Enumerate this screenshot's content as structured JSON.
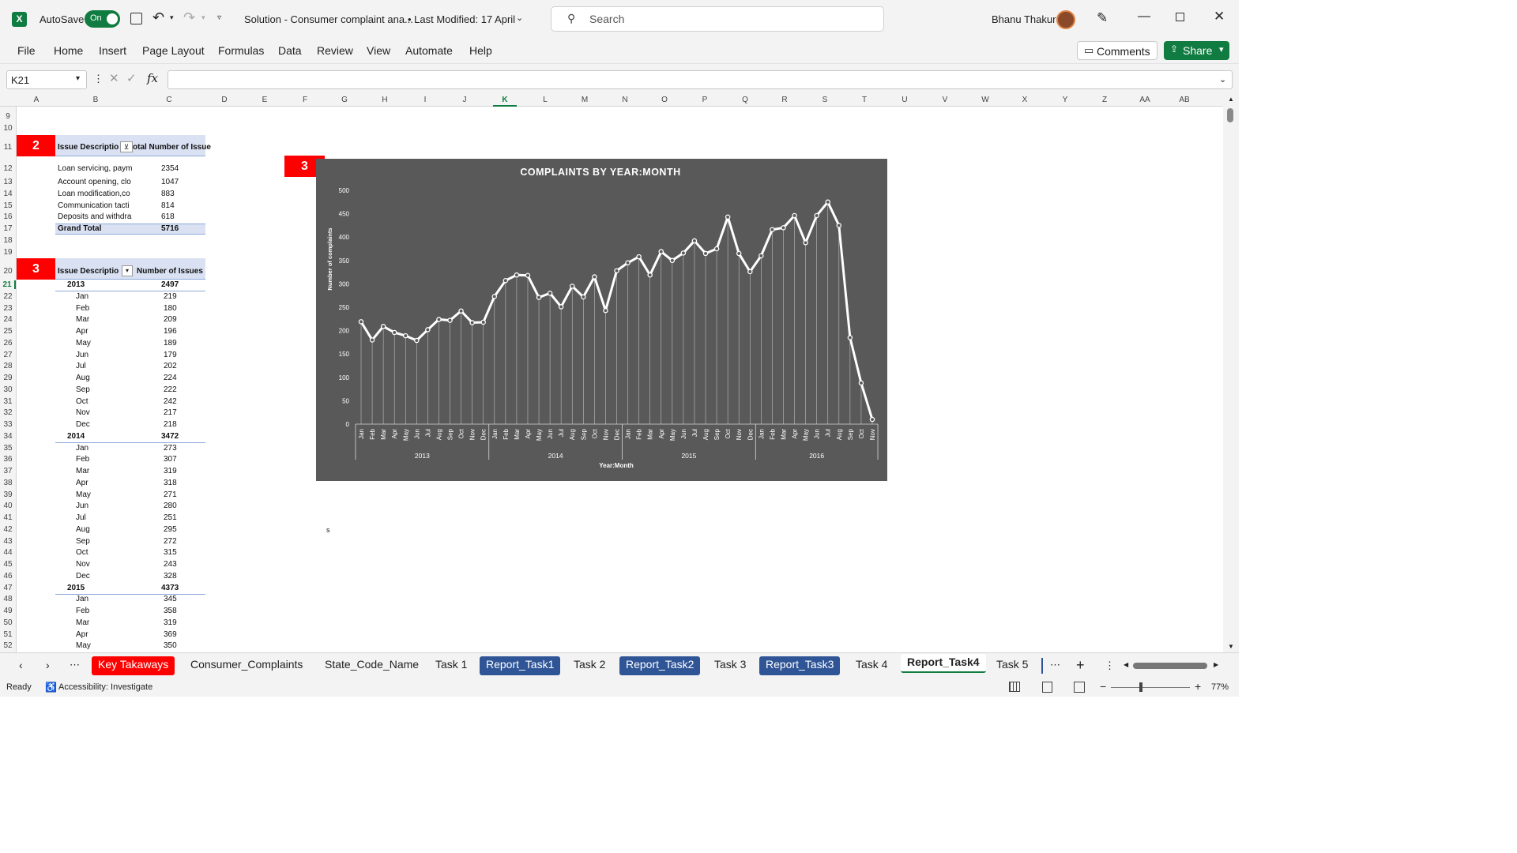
{
  "titlebar": {
    "autosave_label": "AutoSave",
    "autosave_state": "On",
    "doc_title": "Solution - Consumer complaint ana...",
    "last_modified": "• Last Modified: 17 April",
    "search_placeholder": "Search",
    "user_name": "Bhanu Thakur"
  },
  "menu": {
    "items": [
      "File",
      "Home",
      "Insert",
      "Page Layout",
      "Formulas",
      "Data",
      "Review",
      "View",
      "Automate",
      "Help"
    ],
    "comments_label": "Comments",
    "share_label": "Share"
  },
  "formula_bar": {
    "name_box": "K21",
    "fx": "fx",
    "value": ""
  },
  "columns": [
    "A",
    "B",
    "C",
    "D",
    "E",
    "F",
    "G",
    "H",
    "I",
    "J",
    "K",
    "L",
    "M",
    "N",
    "O",
    "P",
    "Q",
    "R",
    "S",
    "T",
    "U",
    "V",
    "W",
    "X",
    "Y",
    "Z",
    "AA",
    "AB"
  ],
  "rows": [
    "8",
    "9",
    "10",
    "11",
    "12",
    "13",
    "14",
    "15",
    "16",
    "17",
    "18",
    "19",
    "20",
    "21",
    "22",
    "23",
    "24",
    "25",
    "26",
    "27",
    "28",
    "29",
    "30",
    "31",
    "32",
    "33",
    "34",
    "35",
    "36",
    "37",
    "38",
    "39",
    "40",
    "41",
    "42",
    "43",
    "44",
    "45",
    "46",
    "47",
    "48",
    "49",
    "50",
    "51",
    "52"
  ],
  "pivot1": {
    "badge": "2",
    "header_col1": "Issue Descriptio",
    "header_col2": "otal Number of Issue",
    "rows": [
      {
        "label": "Loan servicing, paym",
        "value": "2354"
      },
      {
        "label": "Account opening, clo",
        "value": "1047"
      },
      {
        "label": "Loan modification,co",
        "value": "883"
      },
      {
        "label": "Communication tacti",
        "value": "814"
      },
      {
        "label": "Deposits and withdra",
        "value": "618"
      }
    ],
    "total_label": "Grand Total",
    "total_value": "5716"
  },
  "pivot2": {
    "badge": "3",
    "header_col1": "Issue Descriptio",
    "header_col2": "Number of Issues",
    "groups": [
      {
        "year": "2013",
        "total": "2497",
        "months": [
          [
            "Jan",
            "219"
          ],
          [
            "Feb",
            "180"
          ],
          [
            "Mar",
            "209"
          ],
          [
            "Apr",
            "196"
          ],
          [
            "May",
            "189"
          ],
          [
            "Jun",
            "179"
          ],
          [
            "Jul",
            "202"
          ],
          [
            "Aug",
            "224"
          ],
          [
            "Sep",
            "222"
          ],
          [
            "Oct",
            "242"
          ],
          [
            "Nov",
            "217"
          ],
          [
            "Dec",
            "218"
          ]
        ]
      },
      {
        "year": "2014",
        "total": "3472",
        "months": [
          [
            "Jan",
            "273"
          ],
          [
            "Feb",
            "307"
          ],
          [
            "Mar",
            "319"
          ],
          [
            "Apr",
            "318"
          ],
          [
            "May",
            "271"
          ],
          [
            "Jun",
            "280"
          ],
          [
            "Jul",
            "251"
          ],
          [
            "Aug",
            "295"
          ],
          [
            "Sep",
            "272"
          ],
          [
            "Oct",
            "315"
          ],
          [
            "Nov",
            "243"
          ],
          [
            "Dec",
            "328"
          ]
        ]
      },
      {
        "year": "2015",
        "total": "4373",
        "months": [
          [
            "Jan",
            "345"
          ],
          [
            "Feb",
            "358"
          ],
          [
            "Mar",
            "319"
          ],
          [
            "Apr",
            "369"
          ],
          [
            "May",
            "350"
          ]
        ]
      }
    ]
  },
  "chart_badge": "3",
  "stray_cell": "s",
  "chart_data": {
    "type": "line",
    "title": "COMPLAINTS BY YEAR:MONTH",
    "xlabel": "Year:Month",
    "ylabel": "Number of complaints",
    "ylim": [
      0,
      500
    ],
    "yticks": [
      0,
      50,
      100,
      150,
      200,
      250,
      300,
      350,
      400,
      450,
      500
    ],
    "grid": false,
    "background": "#595959",
    "line_color": "#ffffff",
    "years": [
      "2013",
      "2014",
      "2015",
      "2016"
    ],
    "months_per_year": [
      12,
      12,
      12,
      11
    ],
    "month_labels": [
      "Jan",
      "Feb",
      "Mar",
      "Apr",
      "May",
      "Jun",
      "Jul",
      "Aug",
      "Sep",
      "Oct",
      "Nov",
      "Dec"
    ],
    "series": [
      {
        "values": [
          219,
          180,
          209,
          196,
          189,
          179,
          202,
          224,
          222,
          242,
          217,
          218,
          273,
          307,
          319,
          318,
          271,
          280,
          251,
          295,
          272,
          315,
          243,
          328,
          345,
          358,
          319,
          369,
          350,
          366,
          392,
          365,
          375,
          443,
          365,
          326,
          360,
          416,
          420,
          446,
          388,
          446,
          475,
          425,
          185,
          88,
          10
        ]
      }
    ]
  },
  "tabs": {
    "items": [
      {
        "label": "Key Takaways",
        "style": "red"
      },
      {
        "label": "Consumer_Complaints",
        "style": "plain"
      },
      {
        "label": "State_Code_Name",
        "style": "plain"
      },
      {
        "label": "Task 1",
        "style": "plain"
      },
      {
        "label": "Report_Task1",
        "style": "blue"
      },
      {
        "label": "Task 2",
        "style": "plain"
      },
      {
        "label": "Report_Task2",
        "style": "blue"
      },
      {
        "label": "Task 3",
        "style": "plain"
      },
      {
        "label": "Report_Task3",
        "style": "blue"
      },
      {
        "label": "Task 4",
        "style": "plain"
      },
      {
        "label": "Report_Task4",
        "style": "active"
      },
      {
        "label": "Task 5",
        "style": "plain"
      }
    ]
  },
  "status": {
    "ready": "Ready",
    "accessibility": "Accessibility: Investigate",
    "zoom": "77%"
  },
  "colors": {
    "accent_green": "#107c41",
    "badge_red": "#ff0000",
    "tab_blue": "#2f5597",
    "pivot_header": "#d9e1f2"
  }
}
